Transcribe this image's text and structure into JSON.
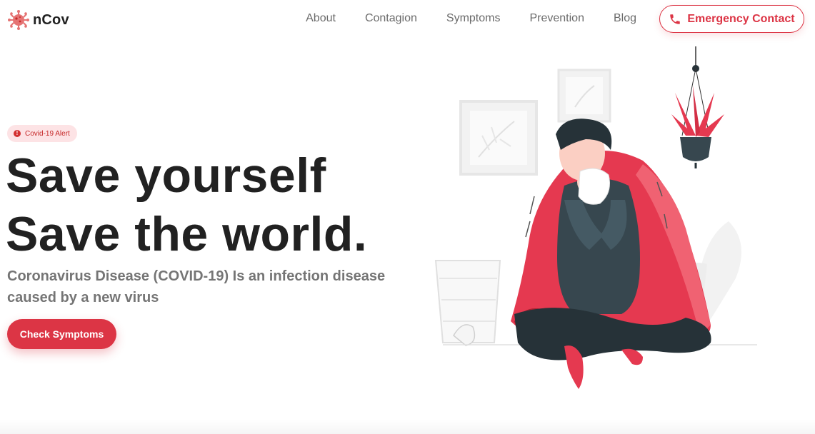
{
  "brand": {
    "name": "nCov",
    "logo_icon": "virus-icon"
  },
  "nav": {
    "links": [
      {
        "label": "About"
      },
      {
        "label": "Contagion"
      },
      {
        "label": "Symptoms"
      },
      {
        "label": "Prevention"
      },
      {
        "label": "Blog"
      }
    ],
    "emergency": {
      "label": "Emergency Contact",
      "icon": "phone-icon"
    }
  },
  "hero": {
    "badge": {
      "label": "Covid-19 Alert",
      "icon": "alert-icon"
    },
    "headline_line1": "Save yourself",
    "headline_line2": "Save the world.",
    "subtext": "Coronavirus Disease (COVID-19) Is an infection disease caused by a new virus",
    "cta_label": "Check Symptoms"
  },
  "colors": {
    "accent": "#dc3545",
    "text": "#212121",
    "muted": "#757575",
    "badge_bg": "#fde3e5"
  }
}
